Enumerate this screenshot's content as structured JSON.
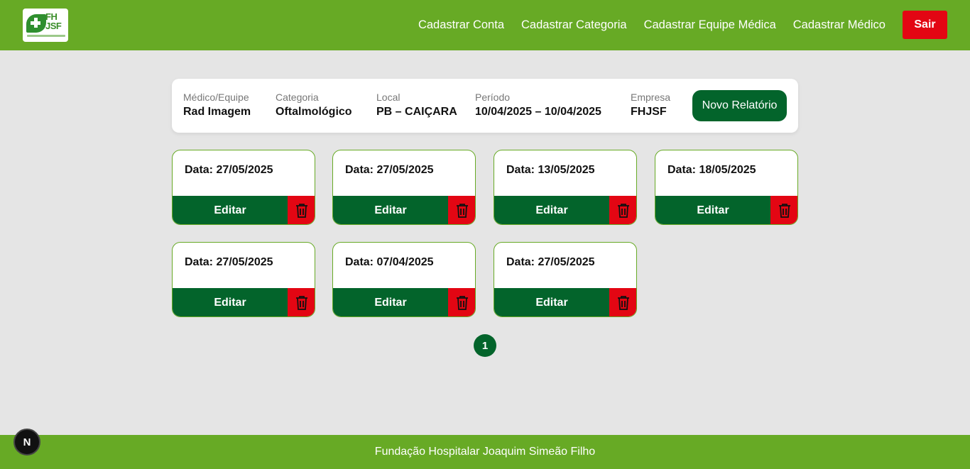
{
  "header": {
    "logo_text": "FH JSF",
    "nav": [
      {
        "label": "Cadastrar Conta"
      },
      {
        "label": "Cadastrar Categoria"
      },
      {
        "label": "Cadastrar Equipe Médica"
      },
      {
        "label": "Cadastrar Médico"
      }
    ],
    "logout_label": "Sair"
  },
  "info": {
    "fields": [
      {
        "label": "Médico/Equipe",
        "value": "Rad Imagem"
      },
      {
        "label": "Categoria",
        "value": "Oftalmológico"
      },
      {
        "label": "Local",
        "value": "PB – CAIÇARA"
      },
      {
        "label": "Período",
        "value": "10/04/2025 – 10/04/2025"
      },
      {
        "label": "Empresa",
        "value": "FHJSF"
      }
    ],
    "new_report_label": "Novo Relatório"
  },
  "reports": [
    {
      "date": "Data: 27/05/2025",
      "edit_label": "Editar"
    },
    {
      "date": "Data: 27/05/2025",
      "edit_label": "Editar"
    },
    {
      "date": "Data: 13/05/2025",
      "edit_label": "Editar"
    },
    {
      "date": "Data: 18/05/2025",
      "edit_label": "Editar"
    },
    {
      "date": "Data: 27/05/2025",
      "edit_label": "Editar"
    },
    {
      "date": "Data: 07/04/2025",
      "edit_label": "Editar"
    },
    {
      "date": "Data: 27/05/2025",
      "edit_label": "Editar"
    }
  ],
  "pagination": {
    "current_page": "1"
  },
  "footer": {
    "text": "Fundação Hospitalar Joaquim Simeão Filho"
  },
  "dev_badge": {
    "label": "N"
  },
  "colors": {
    "header_green": "#67aa25",
    "button_dark_green": "#03642b",
    "danger_red": "#e30613",
    "page_bg": "#e5e5e5"
  }
}
